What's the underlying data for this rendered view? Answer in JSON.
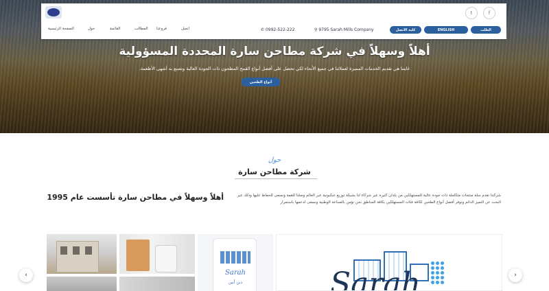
{
  "header": {
    "nav": [
      "الصفحة الرئيسية",
      "حول",
      "القائمة",
      "المطالب",
      "فروعنا",
      "اتصل"
    ],
    "address": "9795 Sarah Mills Company",
    "phone": "0992-522-222",
    "buttons": {
      "request": "الطلب",
      "english": "ENGLISH",
      "contact": "كلية الاتصل"
    },
    "social": [
      "twitter-icon",
      "facebook-icon"
    ]
  },
  "hero": {
    "title": "أهلاً وسهلاً في شركة مطاحن سارة المحددة المسؤولية",
    "subtitle": ".غايتنا هي تقديم الخدمات المميزة لعملائنا في جميع الأنحاء لكي تحصل على أفضل أنواع القمح المطحون ذات الجودة العالية وتصنع به أشهى الأطعمة",
    "button": "أنواع الطحين"
  },
  "about": {
    "kicker": "حول",
    "title": "شركة مطاحن سارة",
    "heading": "أهلاً وسهلاً في مطاحن سارة تأسست عام 1995",
    "body": "شركتنا تقدم سلة منتجات متكاملة ذات جودة عالية للمستهلكين من بلدان كثيرة عبر شركاء لنا بشبكة توزيع عنكبوتية عبر العالم وصلنا للقمة ونسعى للحفاظ عليها وذلك عبر البحث عن التميز الدائم ونوفر أفضل أنواع الطحين لكافة فئات المستهلكين بكافة المناطق نحن نؤمن بالصناعة الوطنية ونسعى لدعمها باستمرار"
  },
  "gallery": {
    "bag_brand": "Sarah",
    "bag_small": "ذين أبين",
    "logo_text": "Sarah"
  },
  "carousel": {
    "prev": "‹",
    "next": "›"
  }
}
